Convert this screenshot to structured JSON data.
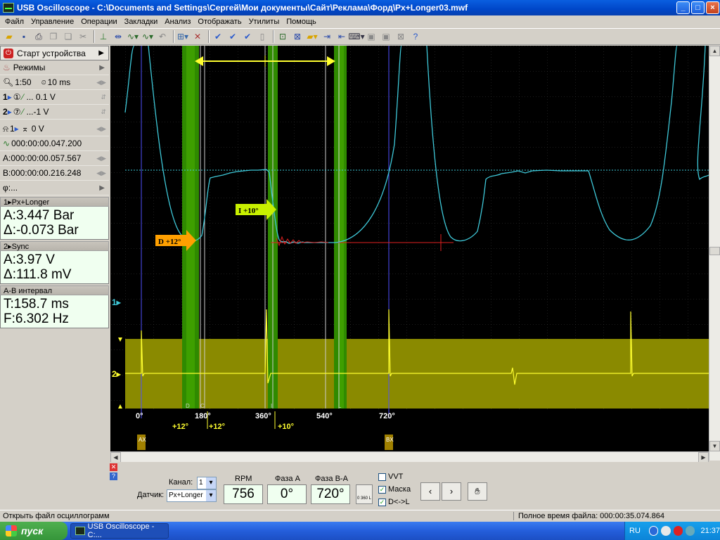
{
  "window": {
    "title": "USB Oscilloscope - C:\\Documents and Settings\\Сергей\\Мои документы\\Сайт\\Реклама\\Форд\\Px+Longer03.mwf"
  },
  "menu": [
    "Файл",
    "Управление",
    "Операции",
    "Закладки",
    "Анализ",
    "Отображать",
    "Утилиты",
    "Помощь"
  ],
  "left": {
    "start_label": "Старт устройства",
    "modes_label": "Режимы",
    "zoom": "1:50",
    "timebase": "10 ms",
    "ch1_setting": "... 0.1 V",
    "ch2_setting": "...-1 V",
    "trigger_level": "0 V",
    "trigger_time": "000:00:00.047.200",
    "cursor_a_time": "A:000:00:00.057.567",
    "cursor_b_time": "B:000:00:00.216.248",
    "phi": "φ:...",
    "ch1_num": "1",
    "ch2_num": "2",
    "ch1_icon": "①",
    "ch2_icon": "⑦",
    "g1_title": "1▸Px+Longer",
    "g1_a": "A:3.447 Bar",
    "g1_d": "Δ:-0.073 Bar",
    "g2_title": "2▸Sync",
    "g2_a": "A:3.97 V",
    "g2_d": "Δ:111.8 mV",
    "g3_title": "A-B интервал",
    "g3_t": "T:158.7 ms",
    "g3_f": "F:6.302 Hz"
  },
  "scope": {
    "ch1_marker": "1▸",
    "ch2_marker": "2▸",
    "label_d": "D +12°",
    "label_i": "I +10°",
    "deg_0": "0°",
    "deg_180": "180°",
    "deg_360": "360°",
    "deg_540": "540°",
    "deg_720": "720°",
    "off_1": "+12°",
    "off_2": "+12°",
    "off_3": "+10°",
    "tag_d": "D",
    "tag_i": "I",
    "tag_l": "L",
    "tag_c": "C",
    "tag_ax": "AX",
    "tag_bx": "BX"
  },
  "controls": {
    "kanal_label": "Канал:",
    "kanal_value": "1",
    "datchik_label": "Датчик:",
    "datchik_value": "Px+Longer",
    "rpm_label": "RPM",
    "rpm_value": "756",
    "faza_a_label": "Фаза A",
    "faza_a_value": "0°",
    "faza_ba_label": "Фаза B-A",
    "faza_ba_value": "720°",
    "deg_mode": "0 360 L",
    "vvt_label": "VVT",
    "maska_label": "Маска",
    "dl_label": "D<->L",
    "prev": "‹",
    "next": "›"
  },
  "status": {
    "left": "Открыть файл осциллограмм",
    "right": "Полное время файла: 000:00:35.074.864"
  },
  "taskbar": {
    "start": "пуск",
    "item": "USB Oscilloscope - C:...",
    "lang": "RU",
    "clock": "21:37"
  },
  "colors": {
    "trace1": "#3ec8d8",
    "trace2": "#ffff30",
    "band": "#2f8a00",
    "ch2bg": "#8a8a00",
    "accent": "#ffa000"
  }
}
